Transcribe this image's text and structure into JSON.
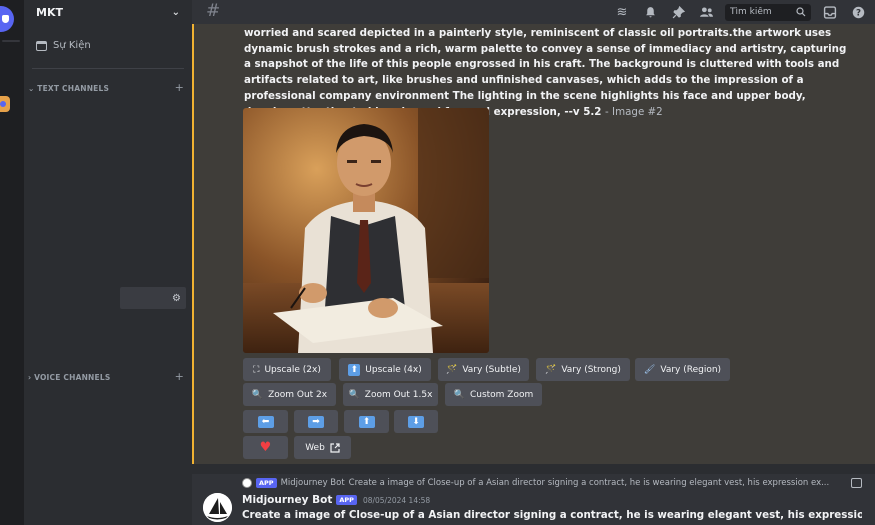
{
  "server": {
    "name": "MKT",
    "events_label": "Sự Kiện",
    "text_category": "TEXT CHANNELS",
    "voice_category": "VOICE CHANNELS"
  },
  "topbar": {
    "search_placeholder": "Tìm kiếm"
  },
  "message": {
    "prompt": "worried and scared depicted in a painterly style, reminiscent of classic oil portraits.the artwork uses dynamic brush strokes and a rich, warm palette to convey a sense of immediacy and artistry, capturing a snapshot of the life of this people engrossed in his craft. The background is cluttered with tools and artifacts related to art, like brushes and unfinished canvases, which adds to the impression of a professional company environment The lighting in the scene highlights his face and upper body, drawing attention to his calm and focused expression, --v 5.2",
    "image_tag": "- Image #2",
    "buttons": {
      "upscale_2x": "Upscale (2x)",
      "upscale_4x": "Upscale (4x)",
      "vary_subtle": "Vary (Subtle)",
      "vary_strong": "Vary (Strong)",
      "vary_region": "Vary (Region)",
      "zoom_out_2x": "Zoom Out 2x",
      "zoom_out_15x": "Zoom Out 1.5x",
      "custom_zoom": "Custom Zoom",
      "web": "Web"
    }
  },
  "next_message": {
    "app_tag": "APP",
    "reply_author": "Midjourney Bot",
    "reply_text": "Create a image of Close-up of a Asian director signing a contract, he is wearing elegant vest, his expression ex...",
    "author": "Midjourney Bot",
    "timestamp": "08/05/2024 14:58",
    "body": "Create a image of Close-up of a Asian director signing a contract, he is wearing elegant vest, his expression extremely"
  },
  "colors": {
    "accent_highlight": "#f0b232",
    "blurple": "#5865f2",
    "button_bg": "#4e5058",
    "heart": "#f23f43"
  }
}
